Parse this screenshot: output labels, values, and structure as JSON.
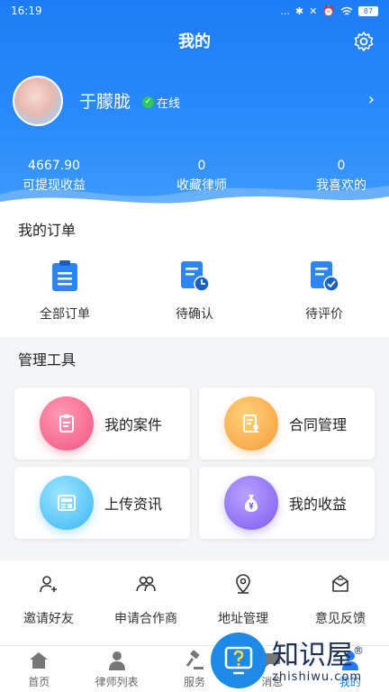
{
  "status_bar": {
    "time": "16:19",
    "indicators": "...",
    "battery": "87"
  },
  "header": {
    "title": "我的"
  },
  "profile": {
    "name": "于朦胧",
    "status": "在线"
  },
  "stats": [
    {
      "value": "4667.90",
      "label": "可提现收益"
    },
    {
      "value": "0",
      "label": "收藏律师"
    },
    {
      "value": "0",
      "label": "我喜欢的"
    }
  ],
  "orders": {
    "title": "我的订单",
    "items": [
      {
        "label": "全部订单",
        "icon": "clipboard-list-icon"
      },
      {
        "label": "待确认",
        "icon": "document-clock-icon"
      },
      {
        "label": "待评价",
        "icon": "document-check-icon"
      }
    ]
  },
  "tools": {
    "title": "管理工具",
    "items": [
      {
        "label": "我的案件",
        "icon": "case-icon",
        "color": "#f2547e"
      },
      {
        "label": "合同管理",
        "icon": "contract-icon",
        "color": "#f59a3a"
      },
      {
        "label": "上传资讯",
        "icon": "news-icon",
        "color": "#39b6f5"
      },
      {
        "label": "我的收益",
        "icon": "money-bag-icon",
        "color": "#7a5cf0"
      }
    ]
  },
  "quick": [
    {
      "label": "邀请好友",
      "icon": "add-user-icon"
    },
    {
      "label": "申请合作商",
      "icon": "partners-icon"
    },
    {
      "label": "地址管理",
      "icon": "location-pin-icon"
    },
    {
      "label": "意见反馈",
      "icon": "feedback-icon"
    }
  ],
  "tabs": [
    {
      "label": "首页",
      "icon": "home-icon",
      "active": false
    },
    {
      "label": "律师列表",
      "icon": "lawyer-icon",
      "active": false
    },
    {
      "label": "服务",
      "icon": "gavel-icon",
      "active": false
    },
    {
      "label": "消息",
      "icon": "message-icon",
      "active": false
    },
    {
      "label": "我的",
      "icon": "profile-icon",
      "active": true
    }
  ],
  "watermark": {
    "text": "知识屋",
    "sub": "zhishiwu.com",
    "mark": "®"
  },
  "colors": {
    "primary": "#1e7cf6",
    "online": "#31c75a"
  }
}
